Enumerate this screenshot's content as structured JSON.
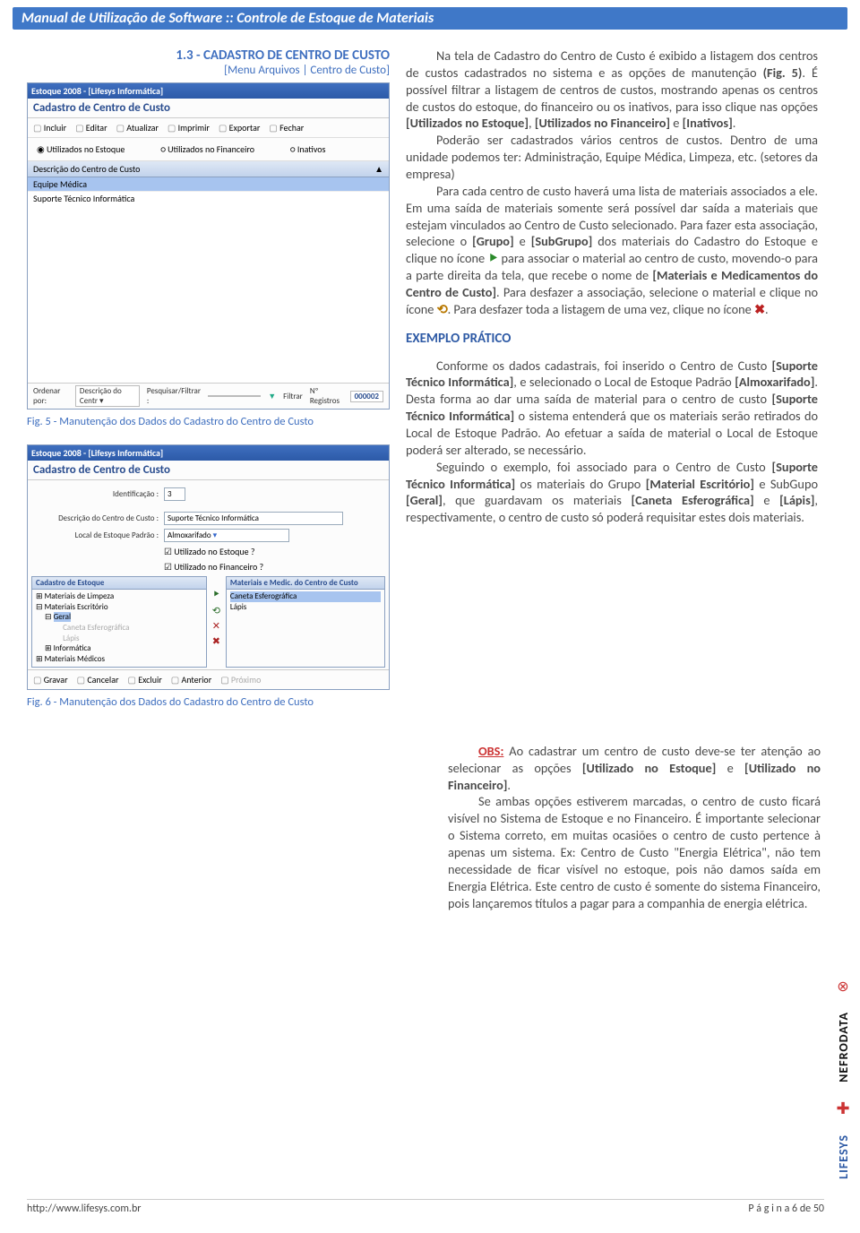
{
  "header": "Manual de Utilização de Software :: Controle de Estoque de Materiais",
  "section": {
    "title": "1.3 - CADASTRO DE CENTRO DE CUSTO",
    "subtitle": "[Menu Arquivos | Centro de Custo]"
  },
  "win5": {
    "app_title": "Estoque 2008 - [Lifesys Informática]",
    "caption": "Cadastro de Centro de Custo",
    "tb": {
      "incluir": "Incluir",
      "editar": "Editar",
      "atualizar": "Atualizar",
      "imprimir": "Imprimir",
      "exportar": "Exportar",
      "fechar": "Fechar"
    },
    "radios": {
      "r1": "Utilizados no Estoque",
      "r2": "Utilizados no Financeiro",
      "r3": "Inativos"
    },
    "col": "Descrição do Centro de Custo",
    "row1": "Equipe Médica",
    "row2": "Suporte Técnico Informática",
    "status": {
      "ordenar": "Ordenar por:",
      "ord_val": "Descrição do Centr ▾",
      "pesq": "Pesquisar/Filtrar :",
      "filtrar": "Filtrar",
      "np": "Nº Registros",
      "np_val": "000002"
    }
  },
  "fig5_caption": "Fig. 5 - Manutenção dos Dados do Cadastro do Centro de Custo",
  "win6": {
    "app_title": "Estoque 2008 - [Lifesys Informática]",
    "caption": "Cadastro de Centro de Custo",
    "ident_label": "Identificação :",
    "ident_val": "3",
    "desc_label": "Descrição do Centro de Custo :",
    "desc_val": "Suporte Técnico Informática",
    "local_label": "Local de Estoque Padrão :",
    "local_val": "Almoxarifado",
    "chk1": "Utilizado no Estoque ?",
    "chk2": "Utilizado no Financeiro ?",
    "panel_l": "Cadastro de Estoque",
    "panel_r": "Materiais e Medic. do Centro de Custo",
    "tree": {
      "n1": "Materiais de Limpeza",
      "n2": "Materiais Escritório",
      "n2a": "Geral",
      "n2a1": "Caneta Esferográfica",
      "n2a2": "Lápis",
      "n3": "Informática",
      "n4": "Materiais Médicos"
    },
    "rlist": {
      "i1": "Caneta Esferográfica",
      "i2": "Lápis"
    },
    "btns": {
      "gravar": "Gravar",
      "cancelar": "Cancelar",
      "excluir": "Excluir",
      "ant": "Anterior",
      "prox": "Próximo"
    }
  },
  "fig6_caption": "Fig. 6 - Manutenção dos Dados do Cadastro do Centro de Custo",
  "text": {
    "p1a": "Na tela de Cadastro do Centro de Custo é exibido a listagem dos centros de custos cadastrados no sistema e as opções de manutenção ",
    "p1b": "(Fig. 5)",
    "p1c": ". É possível filtrar a listagem de centros de custos, mostrando apenas os centros de custos do estoque, do financeiro ou os inativos, para isso clique nas opções ",
    "p1d": "[Utilizados no Estoque]",
    "p1e": ", ",
    "p1f": "[Utilizados no Financeiro]",
    "p1g": " e ",
    "p1h": "[Inativos]",
    "p1i": ".",
    "p2a": "Poderão ser cadastrados vários centros de custos. Dentro de uma unidade podemos ter: Administração, Equipe Médica, Limpeza, etc. (setores da empresa)",
    "p3a": "Para cada centro de custo haverá uma lista de materiais associados a ele. Em uma saída de materiais somente será possível dar saída a materiais que estejam vinculados ao Centro de Custo selecionado. Para fazer esta associação, selecione o ",
    "p3b": "[Grupo]",
    "p3c": " e ",
    "p3d": "[SubGrupo]",
    "p3e": " dos materiais do Cadastro do Estoque e clique no ícone ",
    "p3f": " para associar o material ao centro de custo, movendo-o para a parte direita da tela, que recebe o nome de ",
    "p3g": "[Materiais e Medicamentos do Centro de Custo]",
    "p3h": ". Para desfazer a associação, selecione o material e clique no ícone ",
    "p3i": ". Para desfazer toda a listagem de uma vez, clique no ícone ",
    "p3j": ".",
    "ex_title": "EXEMPLO PRÁTICO",
    "e1a": "Conforme os dados cadastrais, foi inserido o Centro de Custo ",
    "e1b": "[Suporte Técnico Informática]",
    "e1c": ", e selecionado o Local de Estoque Padrão ",
    "e1d": "[Almoxarifado]",
    "e1e": ". Desta forma ao dar uma saída de material para o centro de custo ",
    "e1f": "[Suporte Técnico Informática]",
    "e1g": " o sistema entenderá que os materiais serão retirados do Local de Estoque Padrão. Ao efetuar a saída de material o Local de Estoque poderá ser alterado, se necessário.",
    "e2a": "Seguindo o exemplo, foi associado para o Centro de Custo ",
    "e2b": "[Suporte Técnico Informática]",
    "e2c": " os materiais do Grupo ",
    "e2d": "[Material Escritório]",
    "e2e": " e SubGupo ",
    "e2f": "[Geral]",
    "e2g": ", que guardavam os materiais ",
    "e2h": "[Caneta Esferográfica]",
    "e2i": " e ",
    "e2j": "[Lápis]",
    "e2k": ", respectivamente, o centro de custo só poderá requisitar estes dois materiais.",
    "o1a": "OBS:",
    "o1b": " Ao cadastrar um centro de custo deve-se ter atenção ao selecionar as opções ",
    "o1c": "[Utilizado no Estoque]",
    "o1d": " e ",
    "o1e": "[Utilizado no Financeiro]",
    "o1f": ".",
    "o2": "Se ambas opções estiverem marcadas, o centro de custo ficará visível no Sistema de Estoque e no Financeiro. É importante selecionar o Sistema correto, em muitas ocasiões o centro de custo pertence à apenas um sistema. Ex: Centro de Custo \"Energia Elétrica\", não tem necessidade de ficar visível no estoque, pois não damos saída em Energia Elétrica. Este centro de custo é somente do sistema Financeiro, pois lançaremos títulos a pagar para a companhia de energia elétrica."
  },
  "footer": {
    "url": "http://www.lifesys.com.br",
    "page": "P á g i n a 6 de 50"
  },
  "logos": {
    "nefro": "NEFRODATA",
    "lifesys": "LIFESYS"
  }
}
